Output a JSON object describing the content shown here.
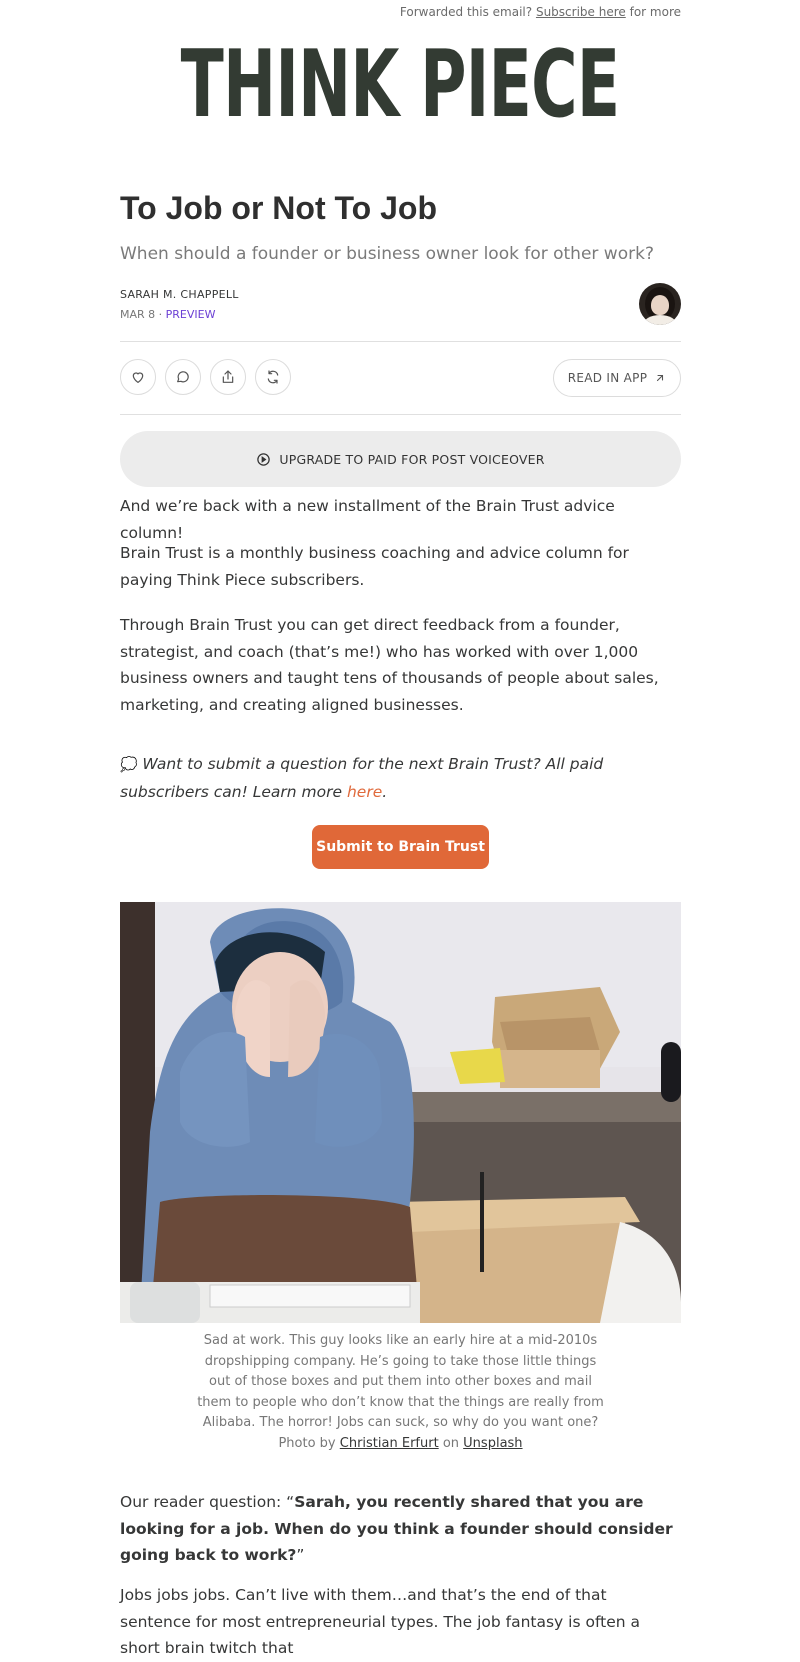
{
  "header": {
    "forward_prefix": "Forwarded this email?",
    "subscribe_link": "Subscribe here",
    "forward_suffix": "for more",
    "logo": "THINK PIECE"
  },
  "post": {
    "title": "To Job or Not To Job",
    "subtitle": "When should a founder or business owner look for other work?",
    "author": "SARAH M. CHAPPELL",
    "date": "MAR 8",
    "separator": "·",
    "tag": "PREVIEW"
  },
  "actions": {
    "icons": [
      "heart-icon",
      "comment-icon",
      "share-icon",
      "restack-icon"
    ],
    "read_in_app": "READ IN APP"
  },
  "voiceover": {
    "label": "UPGRADE TO PAID FOR POST VOICEOVER"
  },
  "body": {
    "p1": "And we’re back with a new installment of the Brain Trust advice column!",
    "p2": "Brain Trust is a monthly business coaching and advice column for paying Think Piece subscribers.",
    "p3": "Through Brain Trust you can get direct feedback from a founder, strategist, and coach (that’s me!) who has worked with over 1,000 business owners and taught tens of thousands of people about sales, marketing, and creating aligned businesses.",
    "note_emoji": "💭",
    "note_text": "Want to submit a question for the next Brain Trust? All paid subscribers can! Learn more",
    "note_link": "here",
    "note_end": ".",
    "cta": "Submit to Brain Trust",
    "caption": "Sad at work. This guy looks like an early hire at a mid-2010s dropshipping company. He’s going to take those little things out of those boxes and put them into other boxes and mail them to people who don’t know that the things are really from Alibaba. The horror! Jobs can suck, so why do you want one?",
    "photo_by": "Photo by",
    "photographer": "Christian Erfurt",
    "photo_on": "on",
    "photo_site": "Unsplash",
    "question_prefix": "Our reader question: “",
    "question": "Sarah, you recently shared that you are looking for a job. When do you think a founder should consider going back to work?",
    "question_suffix": "”",
    "p5": "Jobs jobs jobs. Can’t live with them…and that’s the end of that sentence for most entrepreneurial types. The job fantasy is often a short brain twitch that"
  },
  "colors": {
    "accent": "#e06838",
    "preview": "#6b3fd4",
    "logo": "#333b33"
  }
}
